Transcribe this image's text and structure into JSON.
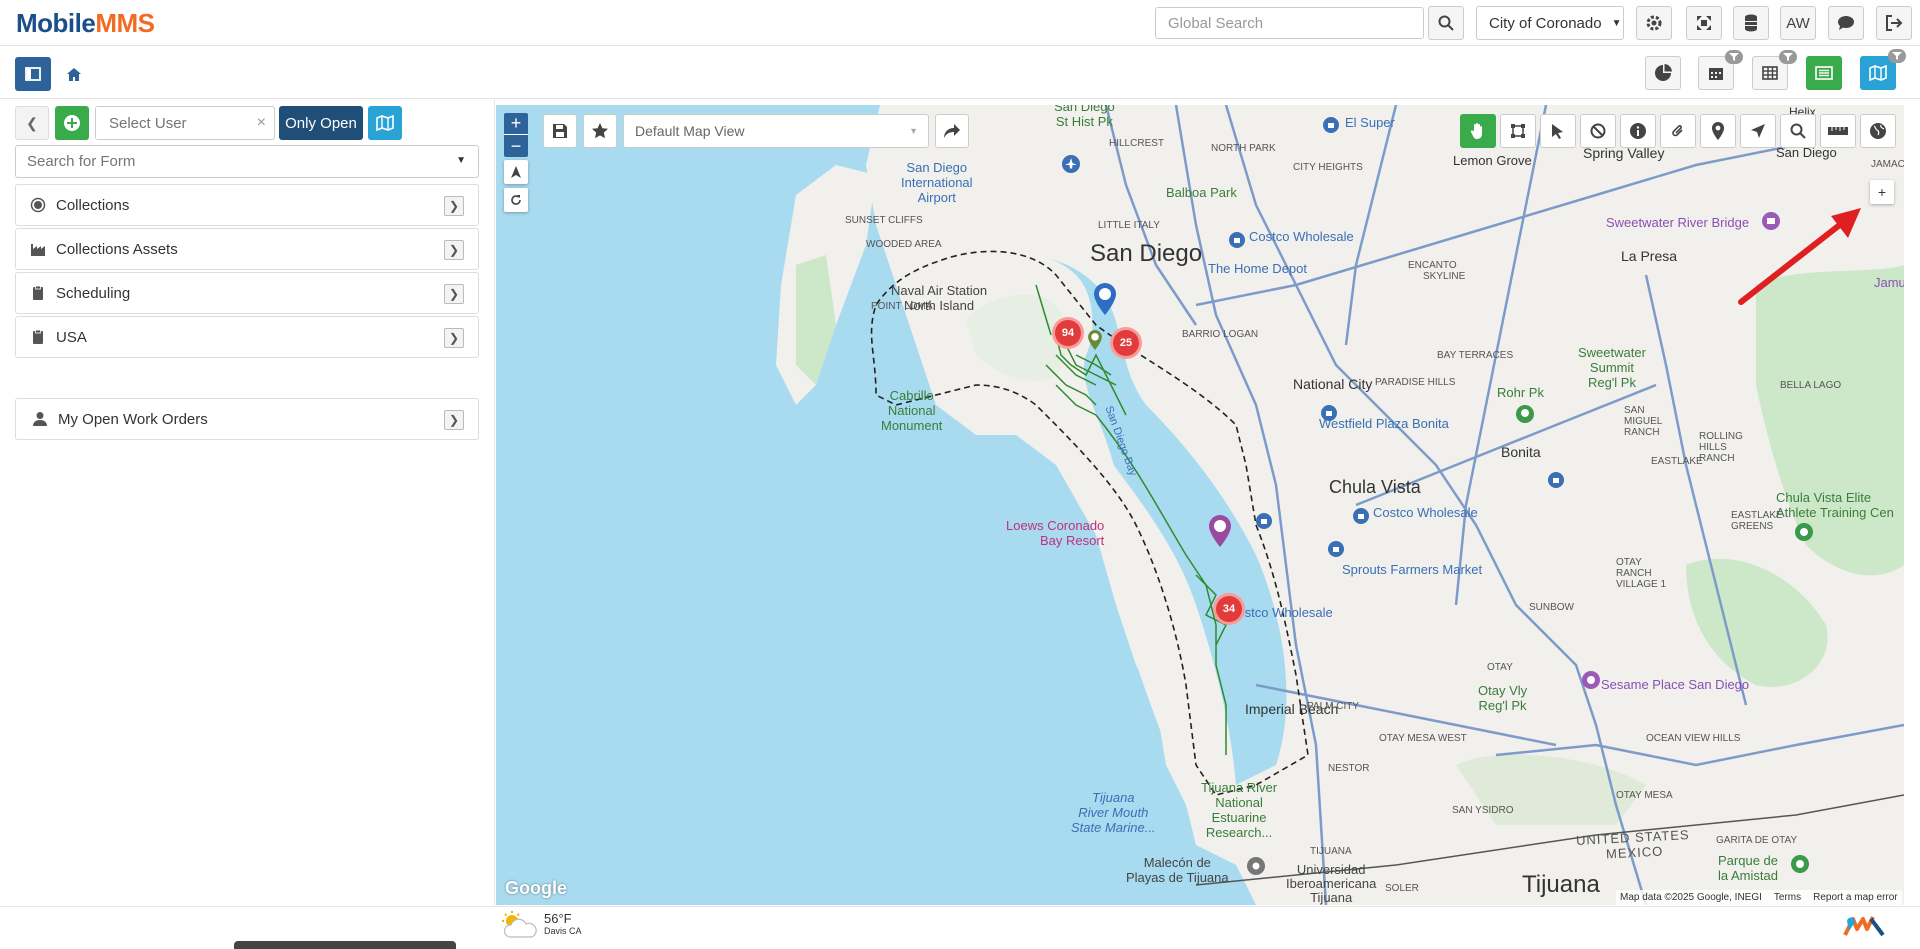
{
  "header": {
    "logo_part1": "Mobile",
    "logo_part2": "MMS",
    "search_placeholder": "Global Search",
    "city": "City of Coronado",
    "user_initials": "AW"
  },
  "leftpanel": {
    "user_placeholder": "Select User",
    "only_open_label": "Only Open",
    "form_search_placeholder": "Search for Form",
    "items": [
      {
        "label": "Collections"
      },
      {
        "label": "Collections Assets"
      },
      {
        "label": "Scheduling"
      },
      {
        "label": "USA"
      }
    ],
    "work_orders_label": "My Open Work Orders"
  },
  "map": {
    "view_name": "Default Map View",
    "clusters": [
      {
        "label": "94"
      },
      {
        "label": "25"
      },
      {
        "label": "34"
      }
    ],
    "places": {
      "san_diego": "San Diego",
      "national_city": "National City",
      "chula_vista": "Chula Vista",
      "imperial_beach": "Imperial Beach",
      "tijuana": "Tijuana",
      "bonita": "Bonita",
      "la_presa": "La Presa",
      "spring_valley": "Spring Valley",
      "lemon_grove": "Lemon Grove",
      "san_diego_ne": "San Diego",
      "balboa": "Balboa Park",
      "airport_1": "San Diego",
      "airport_2": "International",
      "airport_3": "Airport",
      "nas_1": "Naval Air Station",
      "nas_2": "North Island",
      "cabrillo_1": "Cabrillo",
      "cabrillo_2": "National",
      "cabrillo_3": "Monument",
      "sd_bay": "San Diego Bay",
      "loews_1": "Loews Coronado",
      "loews_2": "Bay Resort",
      "costco_1": "Costco Wholesale",
      "costco_2": "Costco Wholesale",
      "costco_3": "Costco Wholesale",
      "home_depot": "The Home Depot",
      "westfield": "Westfield Plaza Bonita",
      "sprouts": "Sprouts Farmers Market",
      "sweetwater_bridge": "Sweetwater River Bridge",
      "sweetwater_1": "Sweetwater",
      "sweetwater_2": "Summit",
      "sweetwater_3": "Reg'l Pk",
      "rohr": "Rohr Pk",
      "otay_1": "Otay Vly",
      "otay_2": "Reg'l Pk",
      "sesame": "Sesame Place San Diego",
      "chula_elite_1": "Chula Vista Elite",
      "chula_elite_2": "Athlete Training Cen",
      "tijuana_reserve_1": "Tijuana River",
      "tijuana_reserve_2": "National",
      "tijuana_reserve_3": "Estuarine",
      "tijuana_reserve_4": "Research...",
      "tijuana_mouth_1": "Tijuana",
      "tijuana_mouth_2": "River Mouth",
      "tijuana_mouth_3": "State Marine...",
      "malecon_1": "Malecón de",
      "malecon_2": "Playas de Tijuana",
      "univ_1": "Universidad",
      "univ_2": "Iberoamericana",
      "univ_3": "Tijuana",
      "parque_1": "Parque de",
      "parque_2": "la Amistad",
      "sd_stl_1": "San Diego",
      "sd_stl_2": "St Hist Pk",
      "el_super": "El Super",
      "jamul": "Jamul",
      "helix": "Helix",
      "us": "UNITED STATES",
      "mx": "MEXICO",
      "small": [
        "NORTH PARK",
        "CITY HEIGHTS",
        "HILLCREST",
        "LITTLE ITALY",
        "SUNSET CLIFFS",
        "WOODED AREA",
        "POINT LOMA",
        "BARRIO LOGAN",
        "ENCANTO",
        "SKYLINE",
        "BAY TERRACES",
        "PARADISE HILLS",
        "SAN MIGUEL RANCH",
        "ROLLING HILLS RANCH",
        "EASTLAKE",
        "BELLA LAGO",
        "EASTLAKE GREENS",
        "OTAY RANCH VILLAGE 1",
        "SUNBOW",
        "OTAY",
        "OTAY MESA WEST",
        "NESTOR",
        "SAN YSIDRO",
        "OTAY MESA",
        "OCEAN VIEW HILLS",
        "GARITA DE OTAY",
        "SOLER",
        "PALM CITY",
        "JAMACH",
        "TIJUANA"
      ]
    },
    "attribution": "Map data ©2025 Google, INEGI",
    "terms": "Terms",
    "report": "Report a map error",
    "google": "Google"
  },
  "weather": {
    "temp": "56°F",
    "location": "Davis CA"
  }
}
